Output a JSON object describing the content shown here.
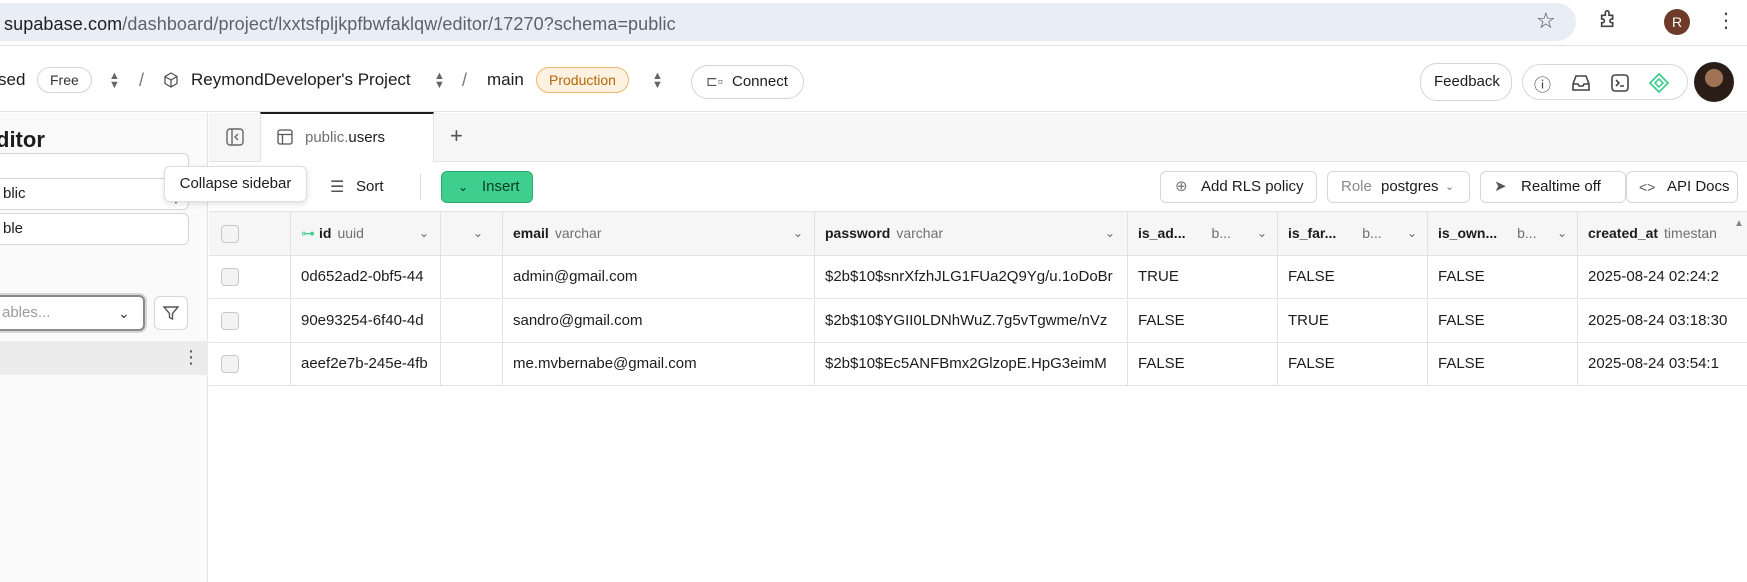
{
  "browser": {
    "url_host": "supabase.com",
    "url_path": "/dashboard/project/lxxtsfpljkpfbwfaklqw/editor/17270?schema=public",
    "profile_initial": "R"
  },
  "header": {
    "org_partial": "sed",
    "plan_badge": "Free",
    "project_name": "ReymondDeveloper's Project",
    "branch": "main",
    "env_badge": "Production",
    "connect_label": "Connect",
    "feedback_label": "Feedback"
  },
  "sidebar": {
    "title": "ditor",
    "schema_value": "blic",
    "new_table_label": "ble",
    "search_placeholder": "ables...",
    "tooltip": "Collapse sidebar"
  },
  "tabs": [
    {
      "schema": "public.",
      "table": "users"
    }
  ],
  "toolbar": {
    "sort_label": "Sort",
    "insert_label": "Insert",
    "rls_label": "Add RLS policy",
    "role_prefix": "Role",
    "role_value": "postgres",
    "realtime_label": "Realtime off",
    "api_docs_label": "API Docs"
  },
  "grid": {
    "columns": [
      {
        "name": "id",
        "type": "uuid"
      },
      {
        "name": "",
        "type": ""
      },
      {
        "name": "email",
        "type": "varchar"
      },
      {
        "name": "password",
        "type": "varchar"
      },
      {
        "name": "is_ad...",
        "type": "b..."
      },
      {
        "name": "is_far...",
        "type": "b..."
      },
      {
        "name": "is_own...",
        "type": "b..."
      },
      {
        "name": "created_at",
        "type": "timestan"
      }
    ],
    "rows": [
      {
        "id": "0d652ad2-0bf5-44",
        "email": "admin@gmail.com",
        "password": "$2b$10$snrXfzhJLG1FUa2Q9Yg/u.1oDoBr",
        "is_admin": "TRUE",
        "is_farmer": "FALSE",
        "is_owner": "FALSE",
        "created_at": "2025-08-24 02:24:2"
      },
      {
        "id": "90e93254-6f40-4d",
        "email": "sandro@gmail.com",
        "password": "$2b$10$YGII0LDNhWuZ.7g5vTgwme/nVz",
        "is_admin": "FALSE",
        "is_farmer": "TRUE",
        "is_owner": "FALSE",
        "created_at": "2025-08-24 03:18:30"
      },
      {
        "id": "aeef2e7b-245e-4fb",
        "email": "me.mvbernabe@gmail.com",
        "password": "$2b$10$Ec5ANFBmx2GlzopE.HpG3eimM",
        "is_admin": "FALSE",
        "is_farmer": "FALSE",
        "is_owner": "FALSE",
        "created_at": "2025-08-24 03:54:1"
      }
    ]
  },
  "colors": {
    "brand_green": "#3ecf8e",
    "production_orange": "#b66606"
  }
}
